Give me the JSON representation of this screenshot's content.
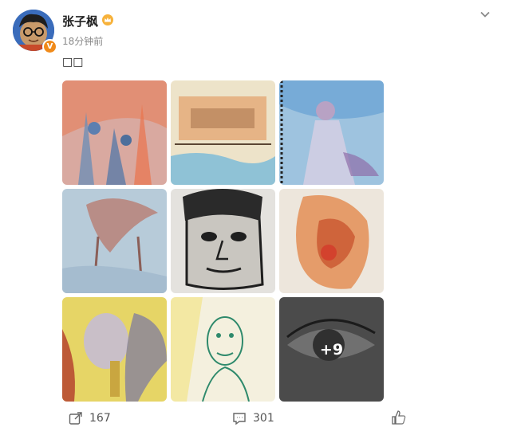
{
  "post": {
    "author": "张子枫",
    "time": "18分钟前",
    "text": "□□",
    "more_count": "+9"
  },
  "actions": {
    "share_count": "167",
    "comment_count": "301"
  },
  "colors": {
    "brand_orange": "#f08a1a",
    "text_muted": "#8a8a8a"
  },
  "icons": [
    "crown-icon",
    "chevron-down-icon",
    "share-icon",
    "comment-icon",
    "like-icon"
  ]
}
